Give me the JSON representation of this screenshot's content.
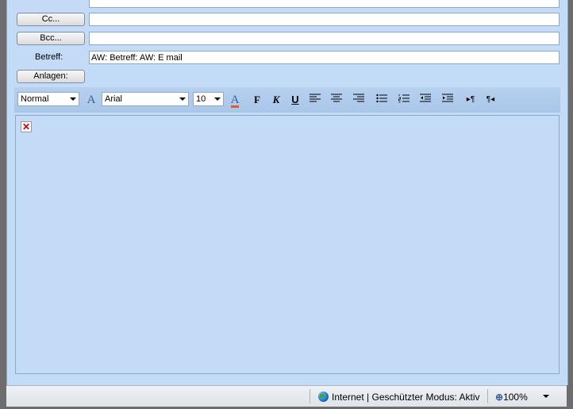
{
  "compose": {
    "cc_button": "Cc...",
    "bcc_button": "Bcc...",
    "cc_value": "",
    "bcc_value": "",
    "subject_label": "Betreff:",
    "subject_value": "AW: Betreff: AW: E mail",
    "attachments_button": "Anlagen:"
  },
  "toolbar": {
    "style_value": "Normal",
    "font_value": "Arial",
    "size_value": "10",
    "bold_icon": "F",
    "italic_icon": "K",
    "underline_icon": "U",
    "font_color": "#e05a2a"
  },
  "editor": {
    "broken_image_glyph": "✕"
  },
  "statusbar": {
    "zone_text": "Internet | Geschützter Modus: Aktiv",
    "zoom_text": "100%"
  },
  "colors": {
    "panel": "#c3dbf7",
    "toolbar": "#a9c6ea"
  }
}
